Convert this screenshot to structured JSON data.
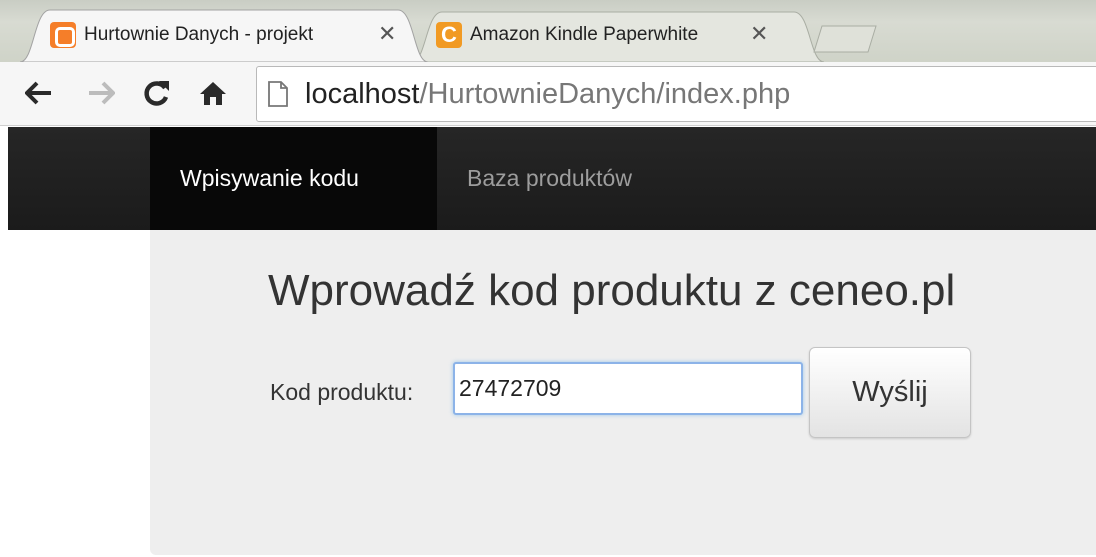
{
  "browser": {
    "tabs": [
      {
        "title": "Hurtownie Danych - projekt",
        "favicon": "xampp-icon",
        "active": true
      },
      {
        "title": "Amazon Kindle Paperwhite",
        "favicon": "ceneo-icon",
        "favicon_letter": "C",
        "active": false
      }
    ],
    "close_glyph": "✕",
    "url": {
      "host": "localhost",
      "path": "/HurtownieDanych/index.php"
    }
  },
  "navbar": {
    "items": [
      {
        "label": "Wpisywanie kodu",
        "active": true
      },
      {
        "label": "Baza produktów",
        "active": false
      }
    ]
  },
  "main": {
    "heading": "Wprowadź kod produktu z ceneo.pl",
    "form": {
      "label": "Kod produktu:",
      "input_value": "27472709",
      "submit_label": "Wyślij"
    }
  },
  "colors": {
    "navbar_bg": "#222222",
    "nav_active_bg": "#080808",
    "nav_inactive_text": "#9d9d9d",
    "jumbotron_bg": "#eeeeee",
    "input_focus_border": "#8cb3e8",
    "xampp_orange": "#f57e29",
    "ceneo_orange": "#f19a23"
  }
}
